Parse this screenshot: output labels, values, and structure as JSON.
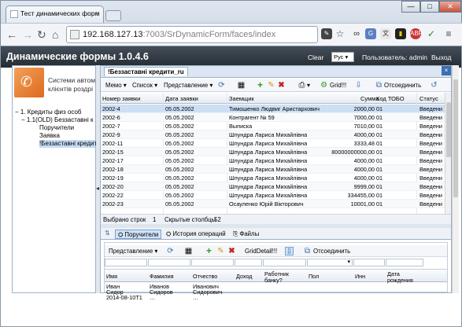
{
  "browser": {
    "tab_title": "Тест динамических форм",
    "tab_close": "×",
    "address_host": "192.168.127.13",
    "address_path": ":7003/SrDynamicForm/faces/index",
    "window_controls": {
      "minimize": "—",
      "maximize": "□",
      "close": "✕"
    }
  },
  "app": {
    "title": "Динамические формы 1.0.4.6",
    "clear_label": "Clear",
    "language_value": "Рус",
    "user_label": "Пользователь: admin",
    "exit_label": "Выход"
  },
  "sidebar": {
    "logo_text_1": "Системи автом",
    "logo_text_2": "клієнтів роздрі",
    "tree": [
      {
        "label": "1. Кредиты физ особ",
        "toggle": "−"
      },
      {
        "label": "1.1(OLD) Беззаставні к",
        "toggle": "−"
      },
      {
        "label": "Поручители"
      },
      {
        "label": "Заявка"
      },
      {
        "label": "!Беззаставні кредити"
      }
    ]
  },
  "panel": {
    "title": "!Беззаставні кредити_ru",
    "close": "×",
    "toolbar": {
      "memo": "Мемо",
      "list": "Список",
      "view": "Представление",
      "grid": "Grid!!!",
      "detach": "Отсоединить"
    },
    "columns": [
      "Номер заявки",
      "Дата заявки",
      "Заемщик",
      "Сумма",
      "Код ТОБО",
      "Статус"
    ],
    "rows": [
      [
        "2002-4",
        "05.05.2002",
        "Тимошенко Людвиг Аристархович",
        "2000,00",
        "01",
        "Введени"
      ],
      [
        "2002-6",
        "05.05.2002",
        "Контрагент № 59",
        "7000,00",
        "01",
        "Введени"
      ],
      [
        "2002-7",
        "05.05.2002",
        "Выписка",
        "7010,00",
        "01",
        "Введени"
      ],
      [
        "2002-9",
        "05.05.2002",
        "Шпундра Лариса Михайлівна",
        "4000,00",
        "01",
        "Введени"
      ],
      [
        "2002-11",
        "05.05.2002",
        "Шпундра Лариса Михайлівна",
        "3333,48",
        "01",
        "Введени"
      ],
      [
        "2002-15",
        "05.05.2002",
        "Шпундра Лариса Михайлівна",
        "80000000000,00",
        "01",
        "Введени"
      ],
      [
        "2002-17",
        "05.05.2002",
        "Шпундра Лариса Михайлівна",
        "4000,00",
        "01",
        "Введени"
      ],
      [
        "2002-18",
        "05.05.2002",
        "Шпундра Лариса Михайлівна",
        "4000,00",
        "01",
        "Введени"
      ],
      [
        "2002-19",
        "05.05.2002",
        "Шпундра Лариса Михайлівна",
        "4000,00",
        "01",
        "Введени"
      ],
      [
        "2002-20",
        "05.05.2002",
        "Шпундра Лариса Михайлівна",
        "9999,00",
        "01",
        "Введени"
      ],
      [
        "2002-22",
        "05.05.2002",
        "Шпундра Лариса Михайлівна",
        "334455,00",
        "01",
        "Введени"
      ],
      [
        "2002-23",
        "05.05.2002",
        "Осауленко Юрій Вікторович",
        "10001,00",
        "01",
        "Введени"
      ]
    ],
    "status": {
      "selected_label": "Выбрано строк",
      "selected_value": "1",
      "hidden_label": "Скрытые столбцы",
      "hidden_value": "52"
    },
    "tabs": [
      "Поручители",
      "История операций",
      "Файлы"
    ],
    "sub_toolbar": {
      "view": "Представление",
      "grid_detail": "GridDetail!!!",
      "detach": "Отсоединить"
    },
    "sub_columns": [
      "Имя",
      "Фамилия",
      "Отчество",
      "Доход",
      "Работник банку?",
      "Пол",
      "Инн",
      "Дата рождения"
    ],
    "sub_rows": [
      [
        "Иван",
        "Иванов",
        "Иванович"
      ],
      [
        "Сидор",
        "Сидоров",
        "Сидорович"
      ],
      [
        "2014-08-10T1",
        "…",
        "…"
      ]
    ]
  },
  "colors": {
    "app_header": "#2b333c",
    "selection": "#ccdff4",
    "accent_blue": "#3c6fb3",
    "add_green": "#2e9b2e",
    "delete_red": "#c62222"
  }
}
